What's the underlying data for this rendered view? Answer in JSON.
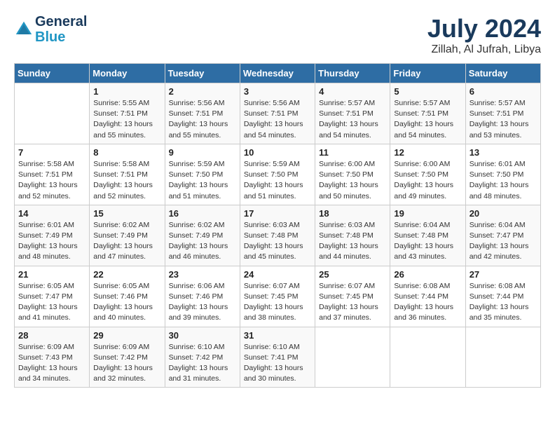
{
  "header": {
    "logo_line1": "General",
    "logo_line2": "Blue",
    "month_title": "July 2024",
    "location": "Zillah, Al Jufrah, Libya"
  },
  "days_of_week": [
    "Sunday",
    "Monday",
    "Tuesday",
    "Wednesday",
    "Thursday",
    "Friday",
    "Saturday"
  ],
  "weeks": [
    [
      {
        "day": "",
        "sunrise": "",
        "sunset": "",
        "daylight": ""
      },
      {
        "day": "1",
        "sunrise": "Sunrise: 5:55 AM",
        "sunset": "Sunset: 7:51 PM",
        "daylight": "Daylight: 13 hours and 55 minutes."
      },
      {
        "day": "2",
        "sunrise": "Sunrise: 5:56 AM",
        "sunset": "Sunset: 7:51 PM",
        "daylight": "Daylight: 13 hours and 55 minutes."
      },
      {
        "day": "3",
        "sunrise": "Sunrise: 5:56 AM",
        "sunset": "Sunset: 7:51 PM",
        "daylight": "Daylight: 13 hours and 54 minutes."
      },
      {
        "day": "4",
        "sunrise": "Sunrise: 5:57 AM",
        "sunset": "Sunset: 7:51 PM",
        "daylight": "Daylight: 13 hours and 54 minutes."
      },
      {
        "day": "5",
        "sunrise": "Sunrise: 5:57 AM",
        "sunset": "Sunset: 7:51 PM",
        "daylight": "Daylight: 13 hours and 54 minutes."
      },
      {
        "day": "6",
        "sunrise": "Sunrise: 5:57 AM",
        "sunset": "Sunset: 7:51 PM",
        "daylight": "Daylight: 13 hours and 53 minutes."
      }
    ],
    [
      {
        "day": "7",
        "sunrise": "Sunrise: 5:58 AM",
        "sunset": "Sunset: 7:51 PM",
        "daylight": "Daylight: 13 hours and 52 minutes."
      },
      {
        "day": "8",
        "sunrise": "Sunrise: 5:58 AM",
        "sunset": "Sunset: 7:51 PM",
        "daylight": "Daylight: 13 hours and 52 minutes."
      },
      {
        "day": "9",
        "sunrise": "Sunrise: 5:59 AM",
        "sunset": "Sunset: 7:50 PM",
        "daylight": "Daylight: 13 hours and 51 minutes."
      },
      {
        "day": "10",
        "sunrise": "Sunrise: 5:59 AM",
        "sunset": "Sunset: 7:50 PM",
        "daylight": "Daylight: 13 hours and 51 minutes."
      },
      {
        "day": "11",
        "sunrise": "Sunrise: 6:00 AM",
        "sunset": "Sunset: 7:50 PM",
        "daylight": "Daylight: 13 hours and 50 minutes."
      },
      {
        "day": "12",
        "sunrise": "Sunrise: 6:00 AM",
        "sunset": "Sunset: 7:50 PM",
        "daylight": "Daylight: 13 hours and 49 minutes."
      },
      {
        "day": "13",
        "sunrise": "Sunrise: 6:01 AM",
        "sunset": "Sunset: 7:50 PM",
        "daylight": "Daylight: 13 hours and 48 minutes."
      }
    ],
    [
      {
        "day": "14",
        "sunrise": "Sunrise: 6:01 AM",
        "sunset": "Sunset: 7:49 PM",
        "daylight": "Daylight: 13 hours and 48 minutes."
      },
      {
        "day": "15",
        "sunrise": "Sunrise: 6:02 AM",
        "sunset": "Sunset: 7:49 PM",
        "daylight": "Daylight: 13 hours and 47 minutes."
      },
      {
        "day": "16",
        "sunrise": "Sunrise: 6:02 AM",
        "sunset": "Sunset: 7:49 PM",
        "daylight": "Daylight: 13 hours and 46 minutes."
      },
      {
        "day": "17",
        "sunrise": "Sunrise: 6:03 AM",
        "sunset": "Sunset: 7:48 PM",
        "daylight": "Daylight: 13 hours and 45 minutes."
      },
      {
        "day": "18",
        "sunrise": "Sunrise: 6:03 AM",
        "sunset": "Sunset: 7:48 PM",
        "daylight": "Daylight: 13 hours and 44 minutes."
      },
      {
        "day": "19",
        "sunrise": "Sunrise: 6:04 AM",
        "sunset": "Sunset: 7:48 PM",
        "daylight": "Daylight: 13 hours and 43 minutes."
      },
      {
        "day": "20",
        "sunrise": "Sunrise: 6:04 AM",
        "sunset": "Sunset: 7:47 PM",
        "daylight": "Daylight: 13 hours and 42 minutes."
      }
    ],
    [
      {
        "day": "21",
        "sunrise": "Sunrise: 6:05 AM",
        "sunset": "Sunset: 7:47 PM",
        "daylight": "Daylight: 13 hours and 41 minutes."
      },
      {
        "day": "22",
        "sunrise": "Sunrise: 6:05 AM",
        "sunset": "Sunset: 7:46 PM",
        "daylight": "Daylight: 13 hours and 40 minutes."
      },
      {
        "day": "23",
        "sunrise": "Sunrise: 6:06 AM",
        "sunset": "Sunset: 7:46 PM",
        "daylight": "Daylight: 13 hours and 39 minutes."
      },
      {
        "day": "24",
        "sunrise": "Sunrise: 6:07 AM",
        "sunset": "Sunset: 7:45 PM",
        "daylight": "Daylight: 13 hours and 38 minutes."
      },
      {
        "day": "25",
        "sunrise": "Sunrise: 6:07 AM",
        "sunset": "Sunset: 7:45 PM",
        "daylight": "Daylight: 13 hours and 37 minutes."
      },
      {
        "day": "26",
        "sunrise": "Sunrise: 6:08 AM",
        "sunset": "Sunset: 7:44 PM",
        "daylight": "Daylight: 13 hours and 36 minutes."
      },
      {
        "day": "27",
        "sunrise": "Sunrise: 6:08 AM",
        "sunset": "Sunset: 7:44 PM",
        "daylight": "Daylight: 13 hours and 35 minutes."
      }
    ],
    [
      {
        "day": "28",
        "sunrise": "Sunrise: 6:09 AM",
        "sunset": "Sunset: 7:43 PM",
        "daylight": "Daylight: 13 hours and 34 minutes."
      },
      {
        "day": "29",
        "sunrise": "Sunrise: 6:09 AM",
        "sunset": "Sunset: 7:42 PM",
        "daylight": "Daylight: 13 hours and 32 minutes."
      },
      {
        "day": "30",
        "sunrise": "Sunrise: 6:10 AM",
        "sunset": "Sunset: 7:42 PM",
        "daylight": "Daylight: 13 hours and 31 minutes."
      },
      {
        "day": "31",
        "sunrise": "Sunrise: 6:10 AM",
        "sunset": "Sunset: 7:41 PM",
        "daylight": "Daylight: 13 hours and 30 minutes."
      },
      {
        "day": "",
        "sunrise": "",
        "sunset": "",
        "daylight": ""
      },
      {
        "day": "",
        "sunrise": "",
        "sunset": "",
        "daylight": ""
      },
      {
        "day": "",
        "sunrise": "",
        "sunset": "",
        "daylight": ""
      }
    ]
  ]
}
